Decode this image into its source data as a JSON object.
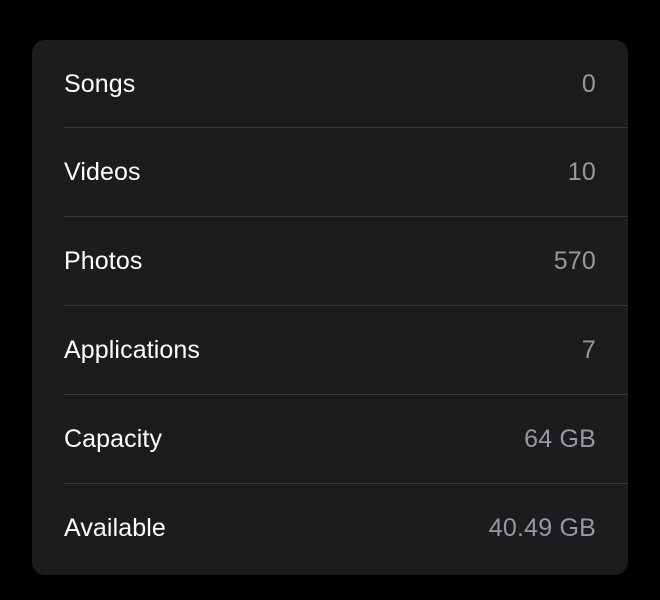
{
  "about": {
    "rows": [
      {
        "label": "Songs",
        "value": "0"
      },
      {
        "label": "Videos",
        "value": "10"
      },
      {
        "label": "Photos",
        "value": "570"
      },
      {
        "label": "Applications",
        "value": "7"
      },
      {
        "label": "Capacity",
        "value": "64 GB"
      },
      {
        "label": "Available",
        "value": "40.49 GB"
      }
    ]
  },
  "colors": {
    "background": "#000000",
    "card": "#1c1c1e",
    "label": "#ffffff",
    "value": "#98989e",
    "separator": "#3a3a3c"
  }
}
